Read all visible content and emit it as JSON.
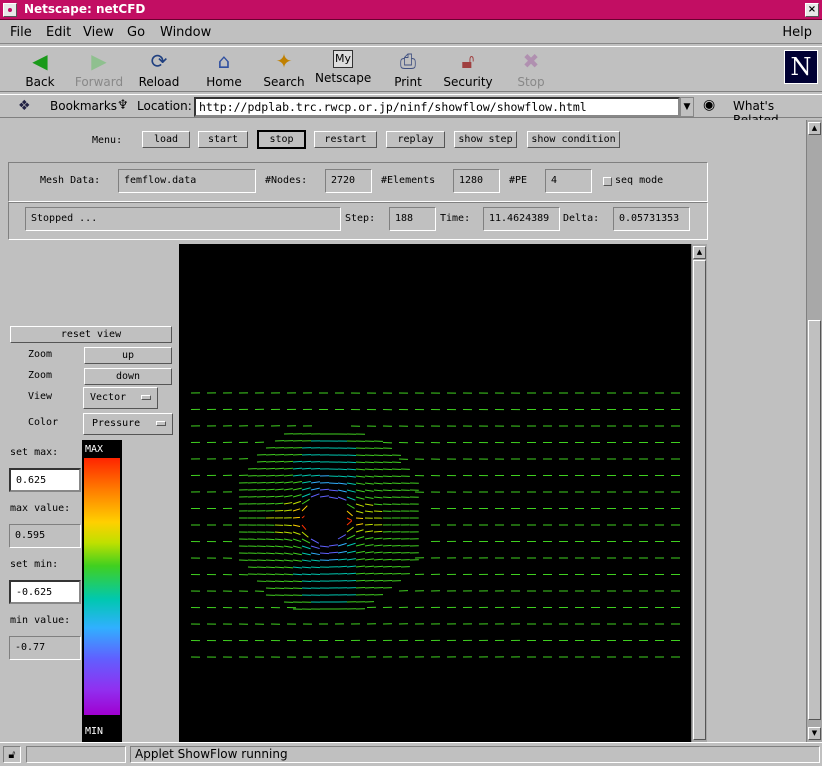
{
  "window": {
    "title": "Netscape: netCFD"
  },
  "menubar": {
    "items": [
      "File",
      "Edit",
      "View",
      "Go",
      "Window"
    ],
    "help": "Help"
  },
  "toolbar": {
    "buttons": [
      {
        "label": "Back",
        "icon": "back-arrow-icon",
        "enabled": true
      },
      {
        "label": "Forward",
        "icon": "forward-arrow-icon",
        "enabled": false
      },
      {
        "label": "Reload",
        "icon": "reload-icon",
        "enabled": true
      },
      {
        "label": "Home",
        "icon": "home-icon",
        "enabled": true
      },
      {
        "label": "Search",
        "icon": "search-icon",
        "enabled": true
      },
      {
        "label": "Netscape",
        "icon": "netscape-icon",
        "enabled": true
      },
      {
        "label": "Print",
        "icon": "print-icon",
        "enabled": true
      },
      {
        "label": "Security",
        "icon": "security-icon",
        "enabled": true
      },
      {
        "label": "Stop",
        "icon": "stop-icon",
        "enabled": false
      }
    ],
    "logo": "N"
  },
  "location": {
    "bookmarks_label": "Bookmarks",
    "location_label": "Location:",
    "url": "http://pdplab.trc.rwcp.or.jp/ninf/showflow/showflow.html",
    "whats_related": "What's Related"
  },
  "applet": {
    "menu_label": "Menu:",
    "menu_buttons": [
      "load",
      "start",
      "stop",
      "restart",
      "replay",
      "show step",
      "show condition"
    ],
    "pressed_button": "stop",
    "mesh": {
      "mesh_label": "Mesh Data:",
      "mesh_value": "femflow.data",
      "nodes_label": "#Nodes:",
      "nodes_value": "2720",
      "elements_label": "#Elements",
      "elements_value": "1280",
      "pe_label": "#PE",
      "pe_value": "4",
      "seq_mode_label": "seq mode"
    },
    "status": {
      "message": "Stopped ...",
      "step_label": "Step:",
      "step_value": "188",
      "time_label": "Time:",
      "time_value": "11.4624389",
      "delta_label": "Delta:",
      "delta_value": "0.05731353"
    },
    "controls": {
      "reset_view": "reset view",
      "zoom_label": "Zoom",
      "zoom_up": "up",
      "zoom_down": "down",
      "view_label": "View",
      "view_value": "Vector",
      "color_label": "Color",
      "color_value": "Pressure",
      "set_max_label": "set max:",
      "set_max_value": "0.625",
      "max_value_label": "max value:",
      "max_value": "0.595",
      "set_min_label": "set min:",
      "set_min_value": "-0.625",
      "min_value_label": "min value:",
      "min_value": "-0.77"
    },
    "colorbar": {
      "max_label": "MAX",
      "min_label": "MIN"
    }
  },
  "statusbar": {
    "message": "Applet ShowFlow running"
  }
}
